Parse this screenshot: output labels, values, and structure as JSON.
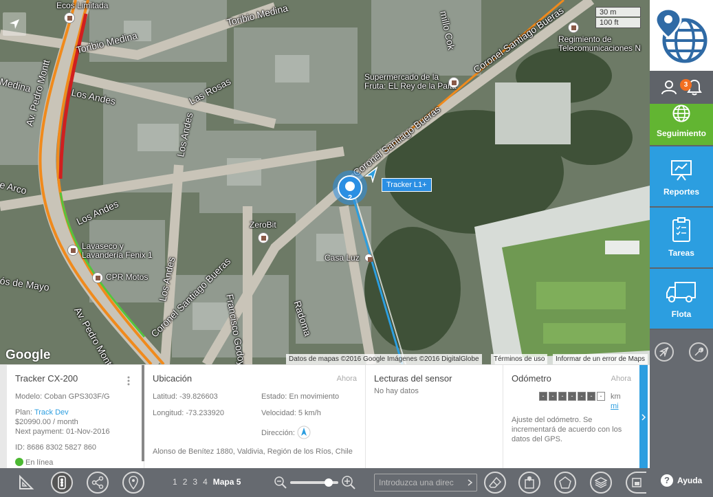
{
  "map": {
    "streets": [
      {
        "id": "toribio1",
        "text": "Toribio Medina"
      },
      {
        "id": "toribio2",
        "text": "Toribio Medina"
      },
      {
        "id": "losandes1",
        "text": "Los Andes"
      },
      {
        "id": "losandes2",
        "text": "Los Andes"
      },
      {
        "id": "losandes3",
        "text": "Los Andes"
      },
      {
        "id": "losandes4",
        "text": "Los Andes"
      },
      {
        "id": "lasrosas",
        "text": "Las Rosas"
      },
      {
        "id": "pedromontt1",
        "text": "Av. Pedro Montt"
      },
      {
        "id": "pedromontt2",
        "text": "Av. Pedro Montt"
      },
      {
        "id": "csb1",
        "text": "Coronel Santiago Bueras"
      },
      {
        "id": "csb2",
        "text": "Coronel Santiago Bueras"
      },
      {
        "id": "csb3",
        "text": "Coronel Santiago Bueras"
      },
      {
        "id": "franciscogodoy",
        "text": "Francisco Godoy"
      },
      {
        "id": "radoma",
        "text": "Radoma"
      },
      {
        "id": "medina",
        "text": "Medina"
      },
      {
        "id": "arco",
        "text": "e Arco"
      },
      {
        "id": "mayo",
        "text": "ós de Mayo"
      },
      {
        "id": "cok",
        "text": "millo Cok"
      }
    ],
    "pois": {
      "ecos": "Ecos Limitada",
      "supermercado_1": "Supermercado de la",
      "supermercado_2": "Fruta: EL Rey de la Palta",
      "regimiento_1": "Regimiento de",
      "regimiento_2": "Telecomunicaciones N",
      "zerobit": "ZeroBit",
      "lavaseco_1": "Lavaseco y",
      "lavaseco_2": "Lavandería Fenix 1",
      "cpr": "CPR Motos",
      "casaluz": "Casa Luz"
    },
    "scale_m": "30 m",
    "scale_ft": "100 ft",
    "tracker_label": "Tracker L1+",
    "cluster_count": "2",
    "google_logo": "Google",
    "attribution": "Datos de mapas ©2016 Google Imágenes ©2016 DigitalGlobe",
    "terms": "Términos de uso",
    "report_error": "Informar de un error de Maps"
  },
  "sidebar": {
    "notification_count": "3",
    "items": [
      {
        "label": "Seguimiento",
        "color": "#62b532",
        "icon": "globe-icon"
      },
      {
        "label": "Reportes",
        "color": "#2c9ee0",
        "icon": "chart-board-icon"
      },
      {
        "label": "Tareas",
        "color": "#2c9ee0",
        "icon": "clipboard-icon"
      },
      {
        "label": "Flota",
        "color": "#2c9ee0",
        "icon": "truck-icon"
      }
    ],
    "help_label": "Ayuda"
  },
  "panel": {
    "device": {
      "title": "Tracker CX-200",
      "model": "Modelo: Coban GPS303F/G",
      "plan_prefix": "Plan:",
      "plan_name": "Track Dev",
      "price": "$20990.00 / month",
      "next_payment": "Next payment: 01-Nov-2016",
      "id": "ID: 8686 8302 5827 860",
      "status": "En línea"
    },
    "location": {
      "title": "Ubicación",
      "now": "Ahora",
      "lat": "Latitud: -39.826603",
      "lon": "Longitud: -73.233920",
      "estado": "Estado: En movimiento",
      "velocidad": "Velocidad: 5 km/h",
      "direccion": "Dirección:",
      "address": "Alonso de Benítez 1880, Valdivia, Región de los Ríos, Chile"
    },
    "sensors": {
      "title": "Lecturas del sensor",
      "empty": "No hay datos"
    },
    "odometer": {
      "title": "Odómetro",
      "now": "Ahora",
      "digits": [
        "-",
        "-",
        "-",
        "-",
        "-",
        "-",
        "-"
      ],
      "unit_km": "km",
      "unit_mi": "mi",
      "note_1": "Ajuste del odómetro. Se",
      "note_2": "incrementará de acuerdo con los",
      "note_3": "datos del GPS."
    }
  },
  "bottom": {
    "pages": [
      "1",
      "2",
      "3",
      "4"
    ],
    "current_page": "Mapa 5",
    "search_placeholder": "Introduzca una direc"
  }
}
